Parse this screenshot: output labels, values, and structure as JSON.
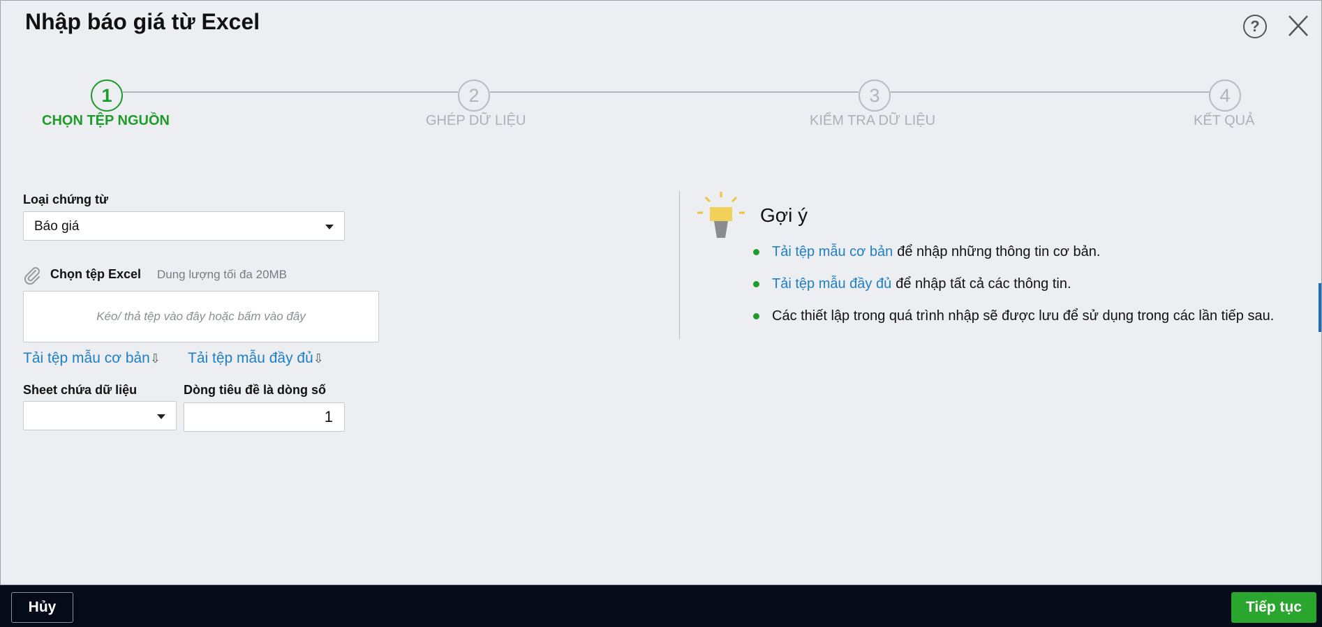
{
  "dialog": {
    "title": "Nhập báo giá từ Excel",
    "help_symbol": "?"
  },
  "steps": [
    {
      "number": "1",
      "label": "CHỌN TỆP NGUỒN",
      "active": true
    },
    {
      "number": "2",
      "label": "GHÉP DỮ LIỆU",
      "active": false
    },
    {
      "number": "3",
      "label": "KIỂM TRA DỮ LIỆU",
      "active": false
    },
    {
      "number": "4",
      "label": "KẾT QUẢ",
      "active": false
    }
  ],
  "form": {
    "doc_type_label": "Loại chứng từ",
    "doc_type_value": "Báo giá",
    "file_label": "Chọn tệp Excel",
    "file_hint": "Dung lượng tối đa 20MB",
    "dropzone_text": "Kéo/ thả tệp vào đây hoặc bấm vào đây",
    "download_basic": "Tải tệp mẫu cơ bản",
    "download_full": "Tải tệp mẫu đầy đủ",
    "download_arrow": "⇩",
    "sheet_label": "Sheet chứa dữ liệu",
    "sheet_value": "",
    "header_row_label": "Dòng tiêu đề là dòng số",
    "header_row_value": "1"
  },
  "tips": {
    "title": "Gợi ý",
    "items": [
      {
        "link": "Tải tệp mẫu cơ bản",
        "text": "để nhập những thông tin cơ bản."
      },
      {
        "link": "Tải tệp mẫu đầy đủ",
        "text": "để nhập tất cả các thông tin."
      },
      {
        "link": "",
        "text": "Các thiết lập trong quá trình nhập sẽ được lưu để sử dụng trong các lần tiếp sau."
      }
    ]
  },
  "footer": {
    "cancel_label": "Hủy",
    "next_label": "Tiếp tục"
  },
  "colors": {
    "active_green": "#1f9b2b",
    "link_blue": "#1e7fc4",
    "footer_bg": "#050b18",
    "primary_button": "#2aa62f"
  },
  "icons": {
    "help": "help-circle-icon",
    "close": "close-icon",
    "attach": "paperclip-icon",
    "tips": "lightbulb-icon",
    "dropdown": "caret-down-icon",
    "download": "download-arrow-icon",
    "bullet": "bullet-dot-icon"
  }
}
